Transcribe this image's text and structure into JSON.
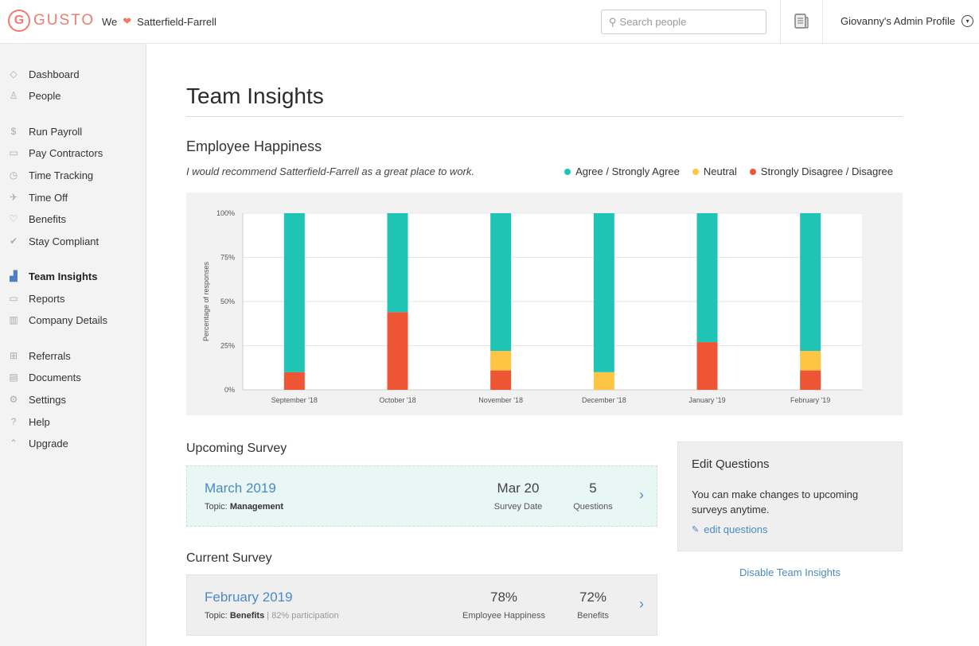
{
  "header": {
    "logo_letter": "G",
    "logo_text": "GUSTO",
    "company_prefix": "We",
    "heart_icon": "heart-icon",
    "company_name": "Satterfield-Farrell",
    "search_placeholder": "Search people",
    "profile_label": "Giovanny's Admin Profile"
  },
  "sidebar": {
    "items": [
      {
        "label": "Dashboard",
        "icon": "dashboard-icon",
        "glyph": "◇"
      },
      {
        "label": "People",
        "icon": "person-icon",
        "glyph": "♙"
      },
      {
        "label": "Run Payroll",
        "icon": "money-bag-icon",
        "glyph": "$"
      },
      {
        "label": "Pay Contractors",
        "icon": "cash-icon",
        "glyph": "▭"
      },
      {
        "label": "Time Tracking",
        "icon": "clock-icon",
        "glyph": "◷"
      },
      {
        "label": "Time Off",
        "icon": "plane-icon",
        "glyph": "✈"
      },
      {
        "label": "Benefits",
        "icon": "heart-outline-icon",
        "glyph": "♡"
      },
      {
        "label": "Stay Compliant",
        "icon": "check-icon",
        "glyph": "✔"
      },
      {
        "label": "Team Insights",
        "icon": "bar-chart-icon",
        "glyph": "▟",
        "active": true
      },
      {
        "label": "Reports",
        "icon": "folder-icon",
        "glyph": "▭"
      },
      {
        "label": "Company Details",
        "icon": "building-icon",
        "glyph": "▥"
      },
      {
        "label": "Referrals",
        "icon": "gift-icon",
        "glyph": "⊞"
      },
      {
        "label": "Documents",
        "icon": "document-icon",
        "glyph": "▤"
      },
      {
        "label": "Settings",
        "icon": "gear-icon",
        "glyph": "⚙"
      },
      {
        "label": "Help",
        "icon": "help-icon",
        "glyph": "?"
      },
      {
        "label": "Upgrade",
        "icon": "upgrade-icon",
        "glyph": "⌃"
      }
    ]
  },
  "main": {
    "page_title": "Team Insights",
    "happiness_title": "Employee Happiness",
    "question": "I would recommend Satterfield-Farrell as a great place to work.",
    "upcoming_title": "Upcoming Survey",
    "current_title": "Current Survey",
    "upcoming": {
      "title": "March 2019",
      "topic_label": "Topic:",
      "topic": "Management",
      "stat1_value": "Mar 20",
      "stat1_label": "Survey Date",
      "stat2_value": "5",
      "stat2_label": "Questions"
    },
    "current": {
      "title": "February 2019",
      "topic_label": "Topic:",
      "topic": "Benefits",
      "participation": "| 82% participation",
      "stat1_value": "78%",
      "stat1_label": "Employee Happiness",
      "stat2_value": "72%",
      "stat2_label": "Benefits"
    },
    "edit_card": {
      "title": "Edit Questions",
      "text": "You can make changes to upcoming surveys anytime.",
      "link": "edit questions"
    },
    "disable_link": "Disable Team Insights"
  },
  "colors": {
    "agree": "#1fc4b4",
    "neutral": "#fdc543",
    "disagree": "#ee5535",
    "link": "#4a8ac6",
    "brand": "#f07b70"
  },
  "chart_data": {
    "type": "bar",
    "stacked": true,
    "title": "Employee Happiness",
    "ylabel": "Percentage of responses",
    "xlabel": "",
    "ylim": [
      0,
      100
    ],
    "yticks": [
      "0%",
      "25%",
      "50%",
      "75%",
      "100%"
    ],
    "grid": true,
    "legend_position": "top-right",
    "categories": [
      "September '18",
      "October '18",
      "November '18",
      "December '18",
      "January '19",
      "February '19"
    ],
    "series": [
      {
        "name": "Strongly Disagree / Disagree",
        "color": "#ee5535",
        "values": [
          10,
          44,
          11,
          0,
          27,
          11
        ]
      },
      {
        "name": "Neutral",
        "color": "#fdc543",
        "values": [
          0,
          0,
          11,
          10,
          0,
          11
        ]
      },
      {
        "name": "Agree / Strongly Agree",
        "color": "#1fc4b4",
        "values": [
          90,
          56,
          78,
          90,
          73,
          78
        ]
      }
    ],
    "legend": [
      "Agree / Strongly Agree",
      "Neutral",
      "Strongly Disagree / Disagree"
    ]
  }
}
